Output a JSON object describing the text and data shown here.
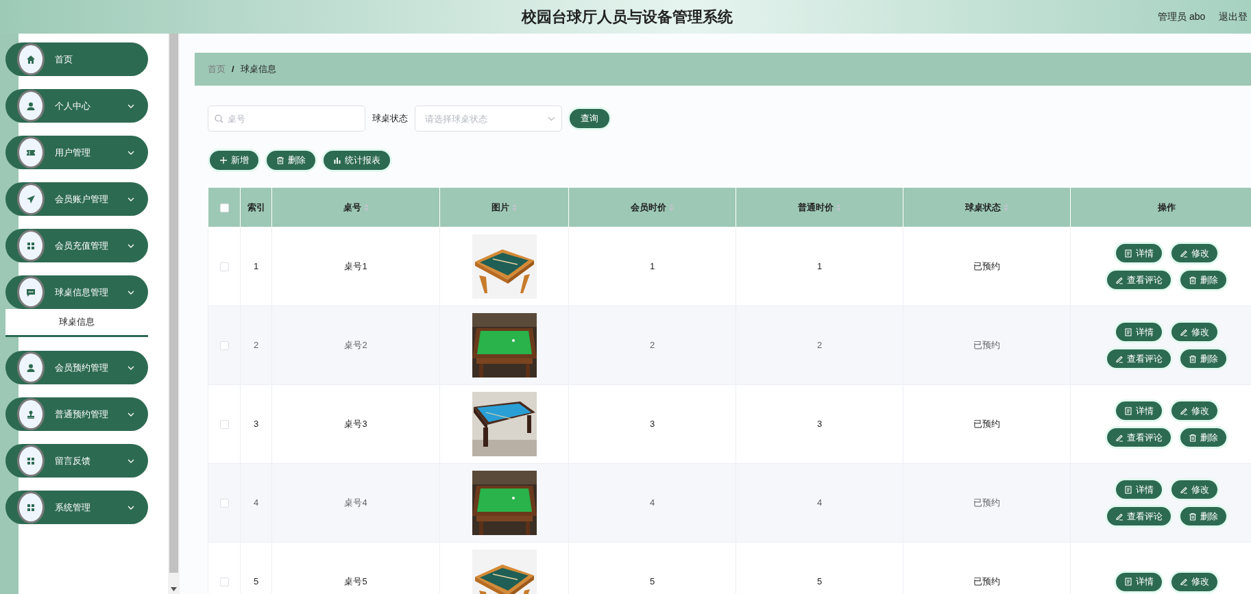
{
  "header": {
    "title": "校园台球厅人员与设备管理系统",
    "user": "管理员 abo",
    "logout": "退出登"
  },
  "sidebar": {
    "items": [
      {
        "label": "首页",
        "kind": "link"
      },
      {
        "label": "个人中心",
        "kind": "group"
      },
      {
        "label": "用户管理",
        "kind": "group"
      },
      {
        "label": "会员账户管理",
        "kind": "group"
      },
      {
        "label": "会员充值管理",
        "kind": "group"
      },
      {
        "label": "球桌信息管理",
        "kind": "group",
        "children": [
          {
            "label": "球桌信息",
            "selected": true
          }
        ]
      },
      {
        "label": "会员预约管理",
        "kind": "group"
      },
      {
        "label": "普通预约管理",
        "kind": "group"
      },
      {
        "label": "留言反馈",
        "kind": "group"
      },
      {
        "label": "系统管理",
        "kind": "group"
      }
    ]
  },
  "breadcrumb": {
    "items": [
      "首页",
      "球桌信息"
    ],
    "separator": "/"
  },
  "search": {
    "placeholder": "桌号",
    "filter_label": "球桌状态",
    "filter_placeholder": "请选择球桌状态",
    "button": "查询"
  },
  "toolbar": [
    {
      "kind": "add",
      "label": "新增"
    },
    {
      "kind": "delete",
      "label": "删除"
    },
    {
      "kind": "report",
      "label": "统计报表"
    }
  ],
  "table": {
    "select_all": {
      "checked": false
    },
    "columns": [
      {
        "label": "索引",
        "sortable": false
      },
      {
        "label": "桌号",
        "sortable": true
      },
      {
        "label": "图片",
        "sortable": true
      },
      {
        "label": "会员时价",
        "sortable": true
      },
      {
        "label": "普通时价",
        "sortable": true
      },
      {
        "label": "球桌状态",
        "sortable": true
      },
      {
        "label": "操作",
        "sortable": false
      }
    ],
    "rows": [
      {
        "checked": false,
        "index": "1",
        "table_no": "桌号1",
        "member_price": "1",
        "normal_price": "1",
        "status": "已预约",
        "actions": [
          {
            "kind": "detail",
            "label": "详情"
          },
          {
            "kind": "edit",
            "label": "修改"
          },
          {
            "kind": "comment",
            "label": "查看评论"
          },
          {
            "kind": "delete",
            "label": "删除"
          }
        ]
      },
      {
        "checked": false,
        "index": "2",
        "table_no": "桌号2",
        "member_price": "2",
        "normal_price": "2",
        "status": "已预约",
        "actions": [
          {
            "kind": "detail",
            "label": "详情"
          },
          {
            "kind": "edit",
            "label": "修改"
          },
          {
            "kind": "comment",
            "label": "查看评论"
          },
          {
            "kind": "delete",
            "label": "删除"
          }
        ]
      },
      {
        "checked": false,
        "index": "3",
        "table_no": "桌号3",
        "member_price": "3",
        "normal_price": "3",
        "status": "已预约",
        "actions": [
          {
            "kind": "detail",
            "label": "详情"
          },
          {
            "kind": "edit",
            "label": "修改"
          },
          {
            "kind": "comment",
            "label": "查看评论"
          },
          {
            "kind": "delete",
            "label": "删除"
          }
        ]
      },
      {
        "checked": false,
        "index": "4",
        "table_no": "桌号4",
        "member_price": "4",
        "normal_price": "4",
        "status": "已预约",
        "actions": [
          {
            "kind": "detail",
            "label": "详情"
          },
          {
            "kind": "edit",
            "label": "修改"
          },
          {
            "kind": "comment",
            "label": "查看评论"
          },
          {
            "kind": "delete",
            "label": "删除"
          }
        ]
      },
      {
        "checked": false,
        "index": "5",
        "table_no": "桌号5",
        "member_price": "5",
        "normal_price": "5",
        "status": "已预约",
        "actions": [
          {
            "kind": "detail",
            "label": "详情"
          },
          {
            "kind": "edit",
            "label": "修改"
          }
        ]
      }
    ]
  }
}
